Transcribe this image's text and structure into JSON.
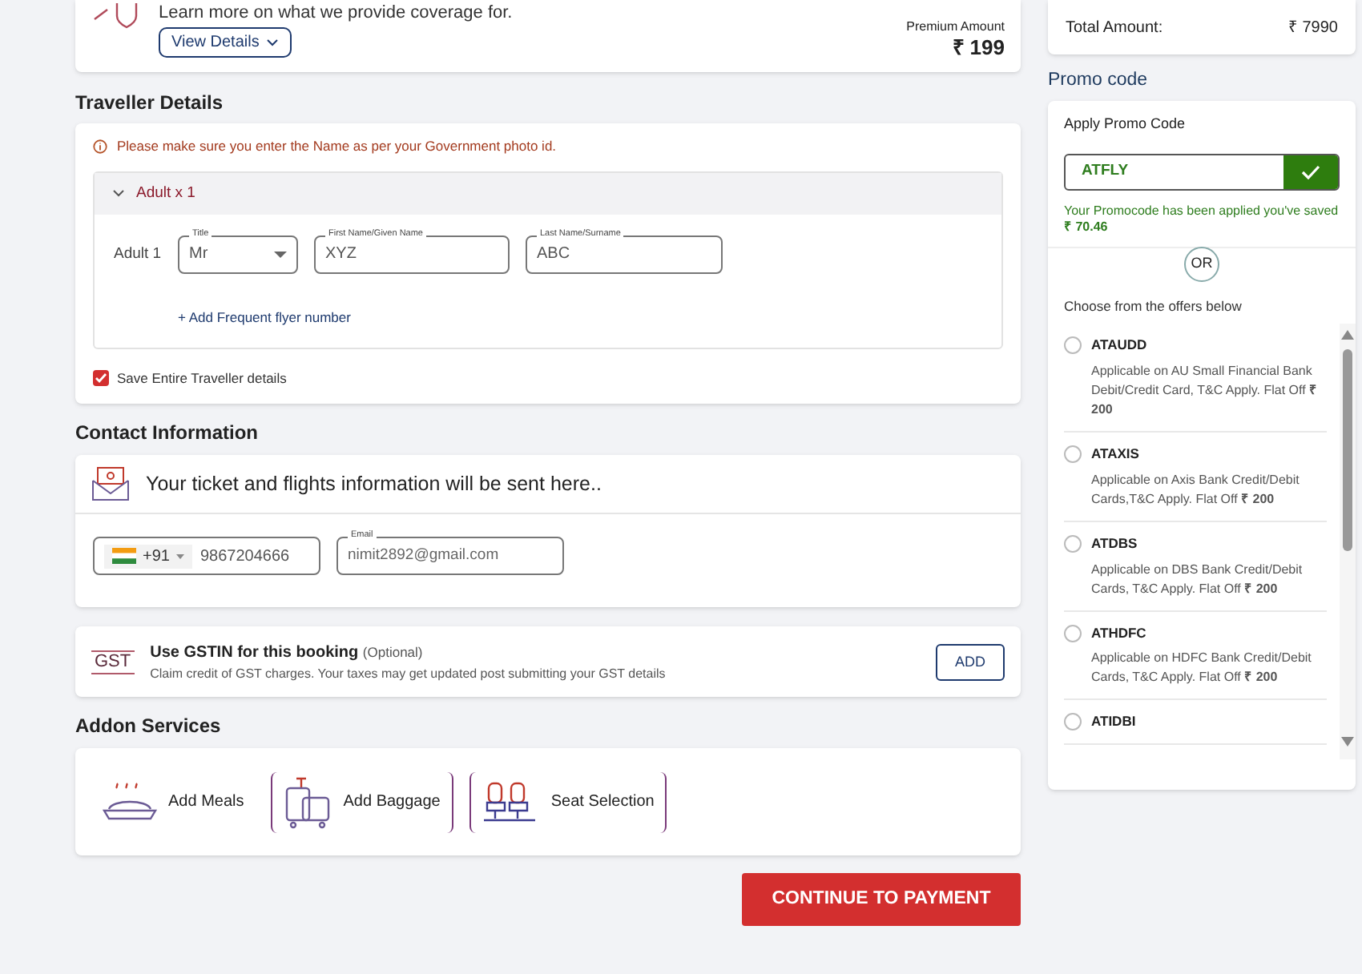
{
  "insurance": {
    "description": "Learn more on what we provide coverage for.",
    "view_details": "View Details",
    "premium_label": "Premium Amount",
    "premium": "₹ 199"
  },
  "traveller": {
    "heading": "Traveller Details",
    "notice": "Please make sure you enter the Name as per your Government photo id.",
    "group": {
      "label": "Adult x 1",
      "expanded": true
    },
    "adult_label": "Adult 1",
    "fields": [
      {
        "kind": "select",
        "label": "Title",
        "value": "Mr"
      },
      {
        "kind": "text",
        "label": "First Name/Given Name",
        "value": "XYZ"
      },
      {
        "kind": "text",
        "label": "Last Name/Surname",
        "value": "ABC"
      }
    ],
    "frequent_flyer": "+ Add Frequent flyer number",
    "save": {
      "label": "Save Entire Traveller details",
      "checked": true
    }
  },
  "contact": {
    "heading": "Contact Information",
    "info": "Your ticket and flights information will be sent here..",
    "country_code": "+91",
    "phone": "9867204666",
    "email_label": "Email",
    "email": "nimit2892@gmail.com"
  },
  "gst": {
    "logo": "GST",
    "title": "Use GSTIN for this booking",
    "optional": "(Optional)",
    "description": "Claim credit of GST charges. Your taxes may get updated post submitting your GST details",
    "button": "ADD"
  },
  "addons": {
    "heading": "Addon Services",
    "items": [
      {
        "kind": "meals",
        "label": "Add Meals"
      },
      {
        "kind": "baggage",
        "label": "Add Baggage"
      },
      {
        "kind": "seat",
        "label": "Seat Selection"
      }
    ]
  },
  "continue_button": "CONTINUE TO PAYMENT",
  "total": {
    "label": "Total Amount:",
    "value": "₹ 7990"
  },
  "promo": {
    "heading": "Promo code",
    "apply_label": "Apply Promo Code",
    "code": "ATFLY",
    "applied": true,
    "message": "Your Promocode has been applied you've saved **₹ 70.46**",
    "or": "OR",
    "offers_heading": "Choose from the offers below",
    "offers": [
      {
        "code": "ATAUDD",
        "description": "Applicable on AU Small Financial Bank Debit/Credit Card, T&C Apply. Flat Off **₹ 200**",
        "selected": false
      },
      {
        "code": "ATAXIS",
        "description": "Applicable on Axis Bank Credit/Debit Cards,T&C Apply. Flat Off **₹ 200**",
        "selected": false
      },
      {
        "code": "ATDBS",
        "description": "Applicable on DBS Bank Credit/Debit Cards, T&C Apply. Flat Off **₹ 200**",
        "selected": false
      },
      {
        "code": "ATHDFC",
        "description": "Applicable on HDFC Bank Credit/Debit Cards, T&C Apply. Flat Off **₹ 200**",
        "selected": false
      },
      {
        "code": "ATIDBI",
        "selected": false
      }
    ]
  }
}
